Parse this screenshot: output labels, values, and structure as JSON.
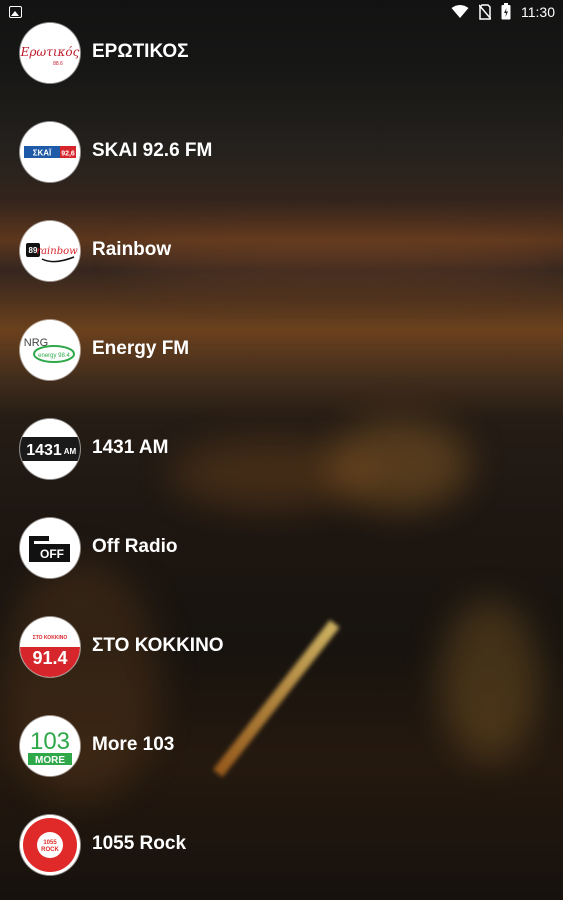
{
  "status_bar": {
    "time": "11:30",
    "icons": [
      "image-icon",
      "wifi-icon",
      "no-sim-icon",
      "battery-icon"
    ]
  },
  "stations": [
    {
      "name": "ΕΡΩΤΙΚΟΣ",
      "logo": "erotikos-logo",
      "logo_text": "Ερωτικός",
      "logo_subtext": "88.6"
    },
    {
      "name": "SKAI 92.6 FM",
      "logo": "skai-logo",
      "logo_text": "ΣΚΑΪ",
      "logo_subtext": "92,6"
    },
    {
      "name": "Rainbow",
      "logo": "rainbow-logo",
      "logo_text": "rainbow",
      "logo_subtext": "89"
    },
    {
      "name": "Energy FM",
      "logo": "energy-logo",
      "logo_text": "NRG",
      "logo_subtext": "energy 98.4"
    },
    {
      "name": "1431 AM",
      "logo": "1431am-logo",
      "logo_text": "1431",
      "logo_subtext": "AM"
    },
    {
      "name": "Off Radio",
      "logo": "off-radio-logo",
      "logo_text": "OFF",
      "logo_subtext": ""
    },
    {
      "name": "ΣΤΟ ΚΟΚΚΙΝΟ",
      "logo": "sto-kokkino-logo",
      "logo_text": "91.4",
      "logo_subtext": "ΣΤΟ ΚΟΚΚΙΝΟ"
    },
    {
      "name": "More 103",
      "logo": "more103-logo",
      "logo_text": "103",
      "logo_subtext": "MORE"
    },
    {
      "name": "1055 Rock",
      "logo": "1055-rock-logo",
      "logo_text": "1055",
      "logo_subtext": "ROCK"
    }
  ],
  "colors": {
    "text": "#ffffff",
    "skai_blue": "#1e5aa8",
    "kokkino_red": "#d7262b",
    "more_green": "#2fa84a",
    "rock_red": "#e02a2a"
  }
}
